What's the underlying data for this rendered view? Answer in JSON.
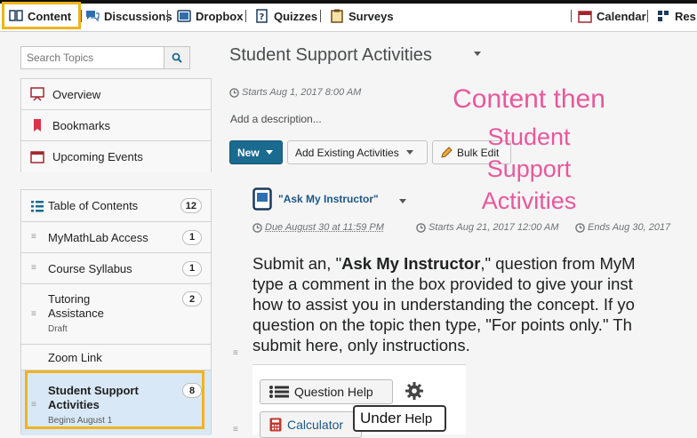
{
  "nav": {
    "items": [
      {
        "label": "Content",
        "icon": "book-icon"
      },
      {
        "label": "Discussions",
        "icon": "discussion-icon"
      },
      {
        "label": "Dropbox",
        "icon": "dropbox-icon"
      },
      {
        "label": "Quizzes",
        "icon": "quiz-icon"
      },
      {
        "label": "Surveys",
        "icon": "survey-icon"
      }
    ],
    "right": [
      {
        "label": "Calendar",
        "icon": "calendar-icon"
      },
      {
        "label": "Res",
        "icon": "resources-icon"
      }
    ]
  },
  "sidebar": {
    "search_placeholder": "Search Topics",
    "top_items": [
      {
        "label": "Overview"
      },
      {
        "label": "Bookmarks"
      },
      {
        "label": "Upcoming Events"
      }
    ],
    "toc": {
      "label": "Table of Contents",
      "count": "12"
    },
    "modules": [
      {
        "label": "MyMathLab Access",
        "count": "1"
      },
      {
        "label": "Course Syllabus",
        "count": "1"
      },
      {
        "label": "Tutoring Assistance",
        "sub": "Draft",
        "count": "2"
      },
      {
        "label": "Zoom Link",
        "count": ""
      },
      {
        "label": "Student Support Activities",
        "sub": "Begins August 1",
        "count": "8"
      }
    ]
  },
  "main": {
    "title": "Student Support Activities",
    "starts": "Starts Aug 1, 2017 8:00 AM",
    "add_description": "Add a description...",
    "buttons": {
      "new": "New",
      "add_existing": "Add Existing Activities",
      "bulk_edit": "Bulk Edit"
    },
    "item": {
      "title": "\"Ask My Instructor\"",
      "due": "Due August 30 at 11:59 PM",
      "starts": "Starts Aug 21, 2017 12:00 AM",
      "ends": "Ends Aug 30, 2017"
    },
    "description": {
      "line1_pre": "Submit an, \"",
      "line1_bold": "Ask My Instructor",
      "line1_post": ",\" question from MyM",
      "line2": "type a comment in the box provided to give your inst",
      "line3": "how to assist you in understanding the concept. If yo",
      "line4": "question on the topic then type, \"For points only.\" Th",
      "line5": "submit here, only instructions."
    },
    "embedded": {
      "question_help": "Question Help",
      "calculator": "Calculator",
      "callout_big": "Under",
      "callout_small": "Help"
    }
  },
  "overlay": {
    "line1": "Content then",
    "line2": "Student",
    "line3": "Support",
    "line4": "Activities"
  },
  "colors": {
    "highlight": "#f0b41c",
    "annotation": "#e8589c",
    "primary_button": "#1b6a8f"
  }
}
